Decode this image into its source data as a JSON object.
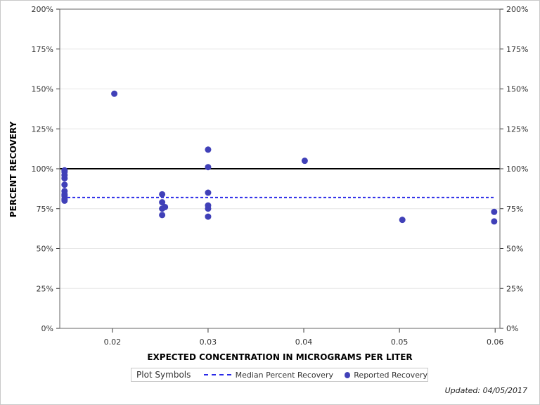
{
  "chart_data": {
    "type": "scatter",
    "title": "",
    "xlabel": "EXPECTED CONCENTRATION IN MICROGRAMS PER LITER",
    "ylabel": "PERCENT RECOVERY",
    "xlim": [
      0.0145,
      0.0605
    ],
    "ylim": [
      0,
      200
    ],
    "x_ticks": [
      0.02,
      0.03,
      0.04,
      0.05,
      0.06
    ],
    "x_tick_labels": [
      "0.02",
      "0.03",
      "0.04",
      "0.05",
      "0.06"
    ],
    "y_ticks": [
      0,
      25,
      50,
      75,
      100,
      125,
      150,
      175,
      200
    ],
    "y_tick_labels": [
      "0%",
      "25%",
      "50%",
      "75%",
      "100%",
      "125%",
      "150%",
      "175%",
      "200%"
    ],
    "grid": true,
    "reference_line": {
      "y": 100,
      "color": "#000000"
    },
    "median_line": {
      "y": 82,
      "color": "#2a2ae8",
      "style": "dashed"
    },
    "series": [
      {
        "name": "Reported Recovery",
        "color": "#4040b8",
        "points": [
          [
            0.015,
            99
          ],
          [
            0.015,
            98
          ],
          [
            0.015,
            96
          ],
          [
            0.015,
            94
          ],
          [
            0.015,
            90
          ],
          [
            0.015,
            86
          ],
          [
            0.015,
            84
          ],
          [
            0.015,
            83
          ],
          [
            0.015,
            81
          ],
          [
            0.015,
            80
          ],
          [
            0.0202,
            147
          ],
          [
            0.0252,
            84
          ],
          [
            0.0252,
            79
          ],
          [
            0.0252,
            75
          ],
          [
            0.0252,
            71
          ],
          [
            0.0255,
            76
          ],
          [
            0.03,
            112
          ],
          [
            0.03,
            101
          ],
          [
            0.03,
            85
          ],
          [
            0.03,
            77
          ],
          [
            0.03,
            75
          ],
          [
            0.03,
            70
          ],
          [
            0.0401,
            105
          ],
          [
            0.0503,
            68
          ],
          [
            0.0599,
            73
          ],
          [
            0.0599,
            67
          ]
        ]
      }
    ]
  },
  "legend": {
    "title": "Plot Symbols",
    "median_label": "Median Percent Recovery",
    "reported_label": "Reported Recovery"
  },
  "footer": {
    "updated_text": "Updated: 04/05/2017"
  }
}
